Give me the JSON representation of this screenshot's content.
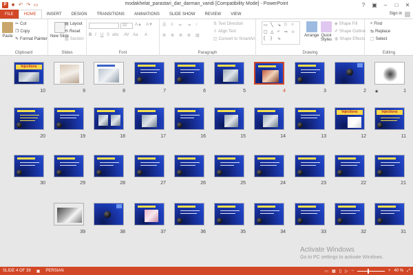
{
  "window": {
    "title": "modakhelat_parastari_dar_darman_varidi [Compatibility Mode] - PowerPoint",
    "signin": "Sign in"
  },
  "tabs": [
    "FILE",
    "HOME",
    "INSERT",
    "DESIGN",
    "TRANSITIONS",
    "ANIMATIONS",
    "SLIDE SHOW",
    "REVIEW",
    "VIEW"
  ],
  "ribbon": {
    "clipboard": {
      "label": "Clipboard",
      "paste": "Paste",
      "cut": "Cut",
      "copy": "Copy",
      "format_painter": "Format Painter"
    },
    "slides": {
      "label": "Slides",
      "new_slide": "New Slide",
      "layout": "Layout",
      "reset": "Reset",
      "section": "Section"
    },
    "font": {
      "label": "Font",
      "size": "32"
    },
    "paragraph": {
      "label": "Paragraph",
      "text_direction": "Text Direction",
      "align_text": "Align Text",
      "convert": "Convert to SmartArt"
    },
    "drawing": {
      "label": "Drawing",
      "arrange": "Arrange",
      "quick_styles": "Quick Styles",
      "shape_fill": "Shape Fill",
      "shape_outline": "Shape Outline",
      "shape_effects": "Shape Effects"
    },
    "editing": {
      "label": "Editing",
      "find": "Find",
      "replace": "Replace",
      "select": "Select"
    }
  },
  "slides": {
    "row1": [
      "10",
      "9",
      "8",
      "7",
      "6",
      "5",
      "4",
      "3",
      "2",
      "1"
    ],
    "row2": [
      "20",
      "19",
      "18",
      "17",
      "16",
      "15",
      "14",
      "13",
      "12",
      "11"
    ],
    "row3": [
      "30",
      "29",
      "28",
      "27",
      "26",
      "25",
      "24",
      "23",
      "22",
      "21"
    ],
    "row4": [
      "39",
      "38",
      "37",
      "36",
      "35",
      "34",
      "33",
      "32",
      "31"
    ],
    "selected": "4",
    "star": "★",
    "injections_label": "Injections"
  },
  "watermark": {
    "line1": "Activate Windows",
    "line2": "Go to PC settings to activate Windows."
  },
  "status": {
    "slide_info": "SLIDE 4 OF 39",
    "language": "PERSIAN",
    "zoom": "40 %",
    "zoom_fraction": 0.4
  },
  "colors": {
    "accent": "#d24726",
    "slide_bg": "#1c3db8",
    "sorter_bg": "#e7e7e7"
  }
}
